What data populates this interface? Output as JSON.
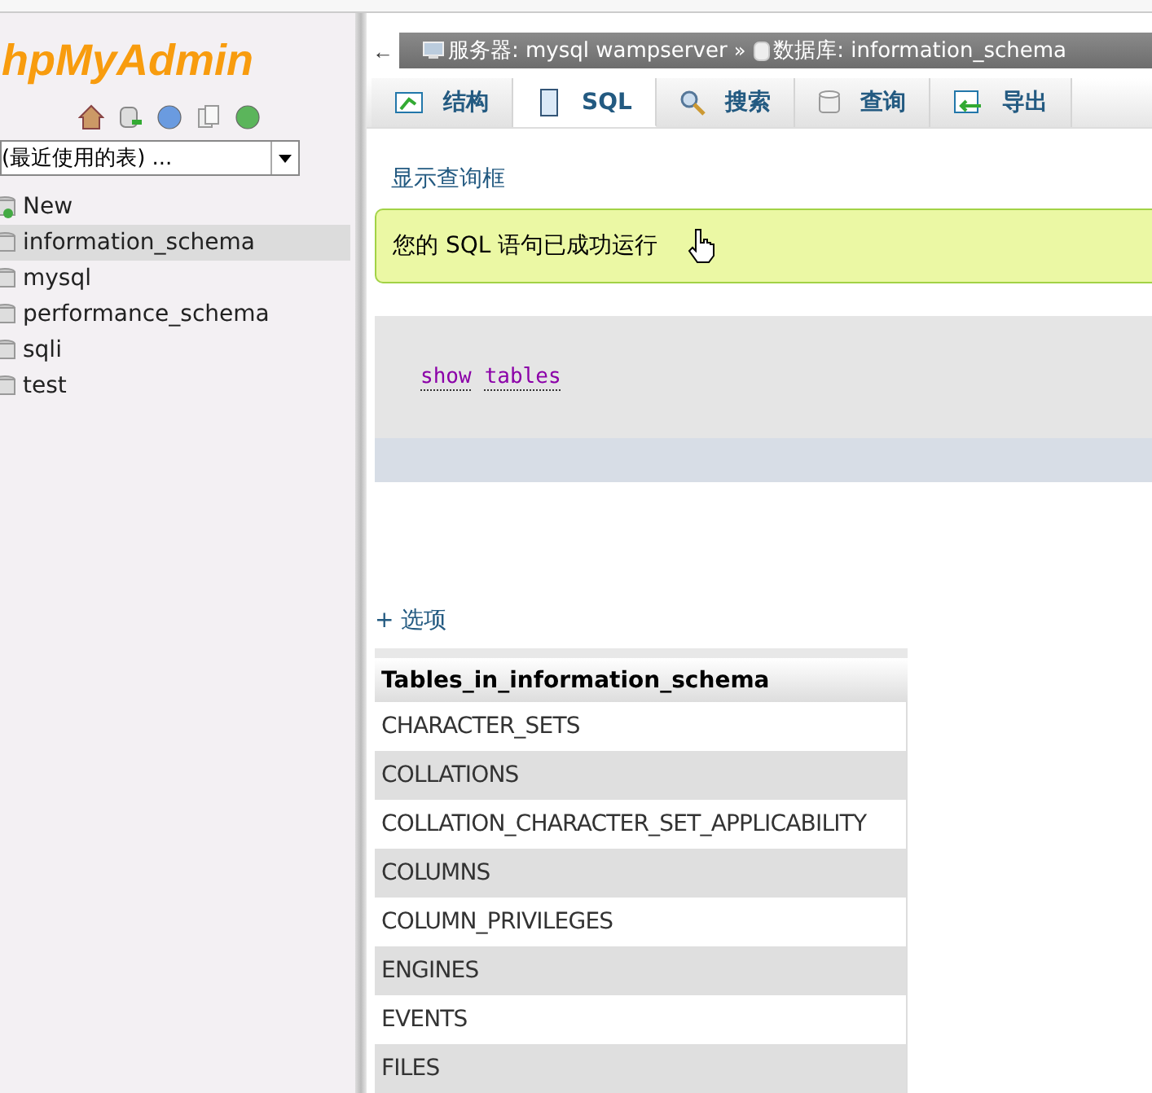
{
  "logo": "hpMyAdmin",
  "recent_tables": {
    "value": "(最近使用的表) ..."
  },
  "databases": [
    {
      "name": "New",
      "kind": "new",
      "selected": false
    },
    {
      "name": "information_schema",
      "kind": "db",
      "selected": true
    },
    {
      "name": "mysql",
      "kind": "db",
      "selected": false
    },
    {
      "name": "performance_schema",
      "kind": "db",
      "selected": false
    },
    {
      "name": "sqli",
      "kind": "db",
      "selected": false
    },
    {
      "name": "test",
      "kind": "db",
      "selected": false
    }
  ],
  "breadcrumb": {
    "back": "←",
    "server": "服务器: mysql wampserver",
    "separator": "»",
    "database": "数据库: information_schema"
  },
  "tabs": [
    {
      "label": "结构",
      "kind": "structure",
      "selected": false
    },
    {
      "label": "SQL",
      "kind": "sql",
      "selected": true
    },
    {
      "label": "搜索",
      "kind": "search",
      "selected": false
    },
    {
      "label": "查询",
      "kind": "query",
      "selected": false
    },
    {
      "label": "导出",
      "kind": "export",
      "selected": false
    }
  ],
  "show_query_link": "显示查询框",
  "success_message": "您的 SQL 语句已成功运行",
  "sql": [
    "show",
    "tables"
  ],
  "options_link": "+ 选项",
  "table": {
    "columns": [
      "Tables_in_information_schema"
    ],
    "rows": [
      "CHARACTER_SETS",
      "COLLATIONS",
      "COLLATION_CHARACTER_SET_APPLICABILITY",
      "COLUMNS",
      "COLUMN_PRIVILEGES",
      "ENGINES",
      "EVENTS",
      "FILES"
    ]
  }
}
